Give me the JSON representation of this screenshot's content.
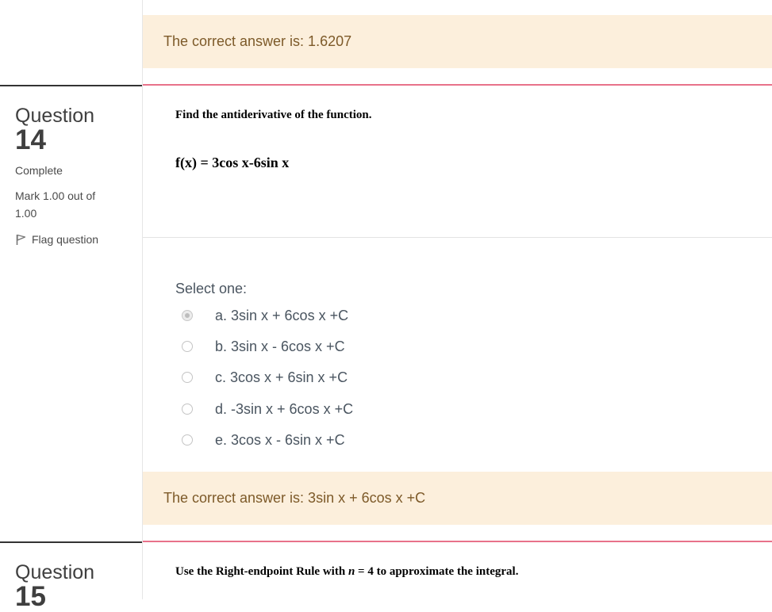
{
  "top_feedback": "The correct answer is: 1.6207",
  "q14": {
    "word": "Question",
    "number": "14",
    "state": "Complete",
    "mark": "Mark 1.00 out of 1.00",
    "flag": "Flag question",
    "instruction": "Find the antiderivative of the function.",
    "function": "f(x) = 3cos x-6sin x",
    "prompt": "Select one:",
    "options": [
      {
        "text": "a. 3sin x + 6cos x +C",
        "selected": true
      },
      {
        "text": "b. 3sin x - 6cos x +C",
        "selected": false
      },
      {
        "text": "c. 3cos x + 6sin x +C",
        "selected": false
      },
      {
        "text": "d. -3sin x + 6cos x +C",
        "selected": false
      },
      {
        "text": "e. 3cos x - 6sin x +C",
        "selected": false
      }
    ],
    "feedback": "The correct answer is: 3sin x + 6cos x +C"
  },
  "q15": {
    "word": "Question",
    "number": "15",
    "instruction_pre": "Use the Right-endpoint Rule with ",
    "instruction_var": "n",
    "instruction_post": " = 4 to approximate the integral."
  }
}
